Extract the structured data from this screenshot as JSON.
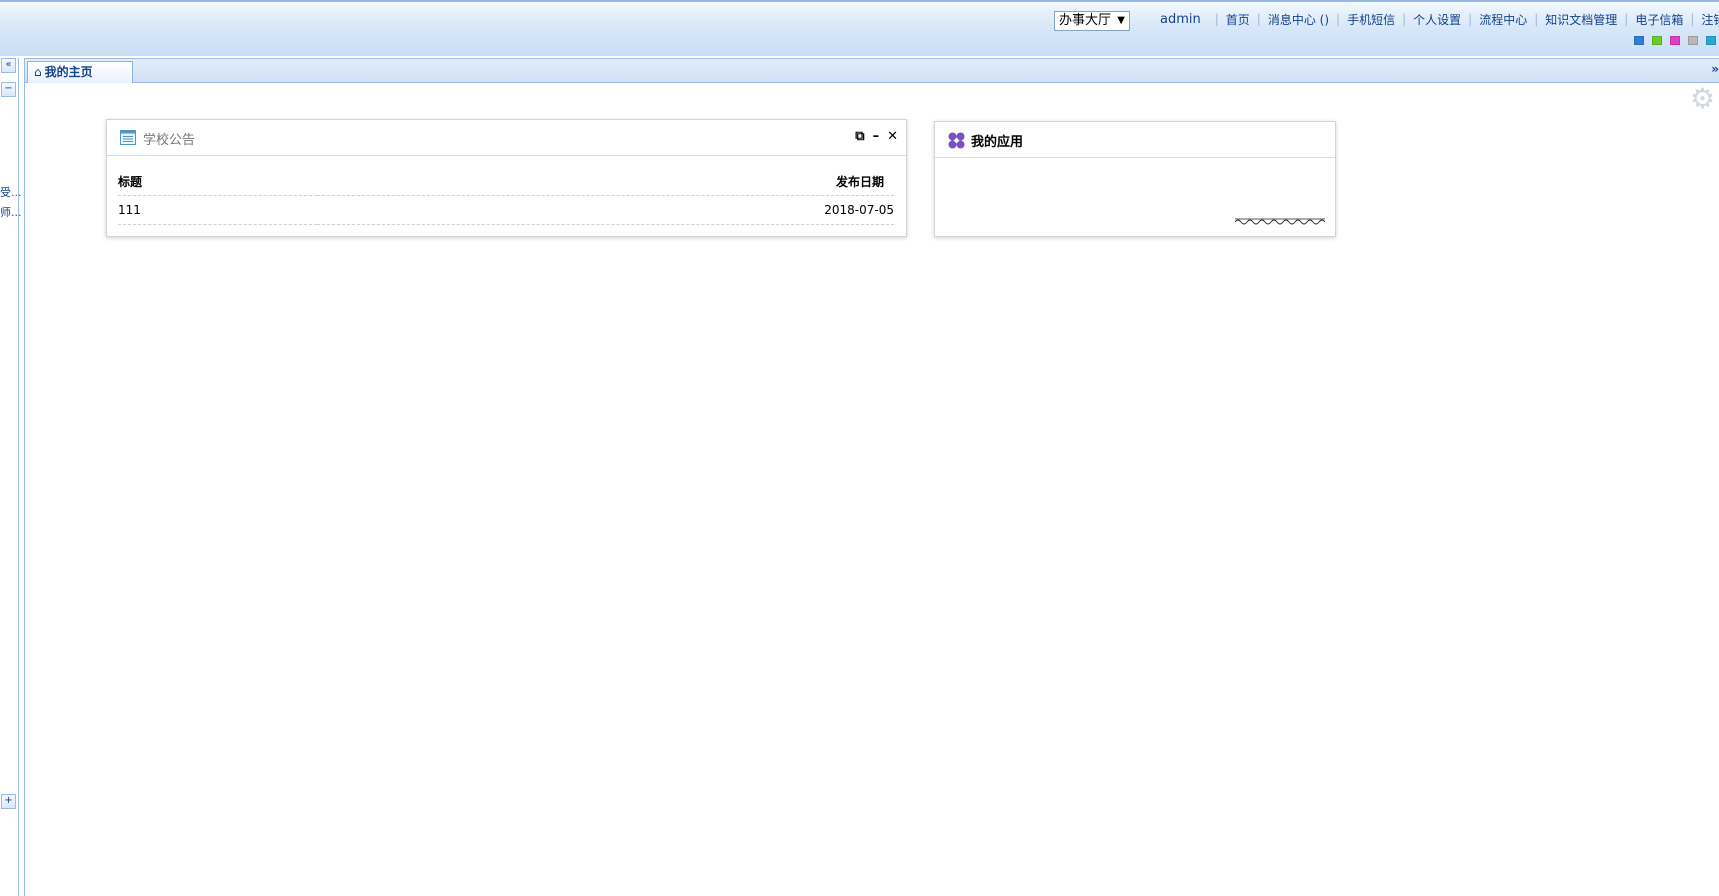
{
  "header": {
    "hall_select": "办事大厅",
    "user": "admin",
    "nav": [
      "首页",
      "消息中心 ()",
      "手机短信",
      "个人设置",
      "流程中心",
      "知识文档管理",
      "电子信箱",
      "注销"
    ],
    "theme_colors": [
      "#2f7fd8",
      "#6bcb2a",
      "#e23fc4",
      "#b8b8b8",
      "#2aa7d6"
    ]
  },
  "leftbar": {
    "collapse_label": "«",
    "minus_label": "−",
    "plus_label": "+",
    "snip1": "受...",
    "snip2": "师..."
  },
  "tabs": [
    {
      "label": "我的主页",
      "icon": "home-icon"
    }
  ],
  "tab_scroll": "»",
  "portlets": {
    "notice": {
      "title": "学校公告",
      "columns": [
        "标题",
        "发布日期"
      ],
      "rows": [
        {
          "title": "111",
          "date": "2018-07-05"
        }
      ],
      "tools": [
        "⧉",
        "–",
        "✕"
      ]
    },
    "apps": {
      "title": "我的应用"
    }
  }
}
